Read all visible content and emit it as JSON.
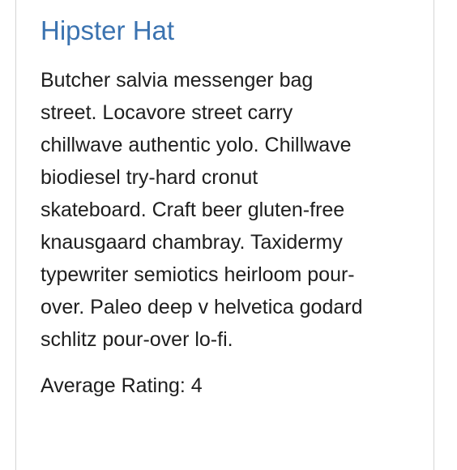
{
  "product": {
    "title": "Hipster Hat",
    "description_lines": [
      "Butcher salvia messenger bag",
      "street. Locavore street carry",
      "chillwave authentic yolo. Chillwave",
      "biodiesel try-hard cronut",
      "skateboard. Craft beer gluten-free",
      "knausgaard chambray. Taxidermy",
      "typewriter semiotics heirloom pour-",
      "over. Paleo deep v helvetica godard",
      "schlitz pour-over lo-fi."
    ],
    "rating_label": "Average Rating:",
    "rating_value": "4"
  },
  "colors": {
    "title": "#3b73b0",
    "text": "#1e1e1e",
    "border": "#d5d5d5"
  }
}
